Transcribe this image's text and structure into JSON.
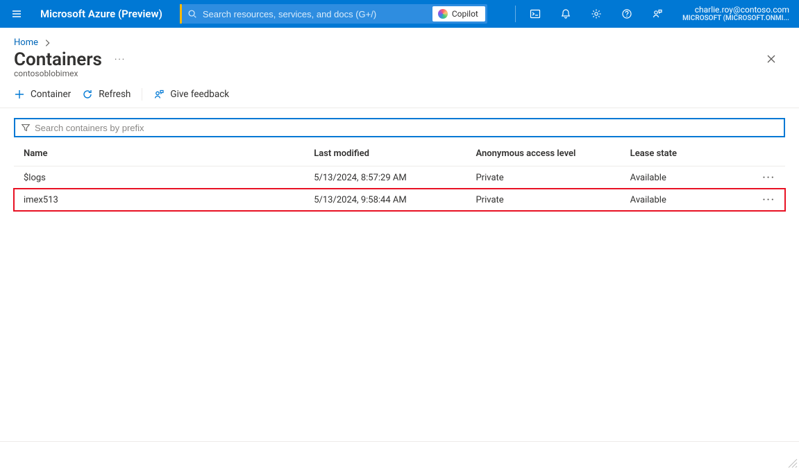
{
  "header": {
    "brand": "Microsoft Azure (Preview)",
    "search_placeholder": "Search resources, services, and docs (G+/)",
    "copilot_label": "Copilot",
    "account_email": "charlie.roy@contoso.com",
    "account_tenant": "MICROSOFT (MICROSOFT.ONMI..."
  },
  "breadcrumb": {
    "items": [
      "Home"
    ]
  },
  "page": {
    "title": "Containers",
    "resource_name": "contosoblobimex"
  },
  "toolbar": {
    "add_container": "Container",
    "refresh": "Refresh",
    "feedback": "Give feedback"
  },
  "filter": {
    "placeholder": "Search containers by prefix"
  },
  "table": {
    "columns": {
      "name": "Name",
      "last_modified": "Last modified",
      "access": "Anonymous access level",
      "lease": "Lease state"
    },
    "rows": [
      {
        "name": "$logs",
        "last_modified": "5/13/2024, 8:57:29 AM",
        "access": "Private",
        "lease": "Available",
        "highlighted": false
      },
      {
        "name": "imex513",
        "last_modified": "5/13/2024, 9:58:44 AM",
        "access": "Private",
        "lease": "Available",
        "highlighted": true
      }
    ]
  }
}
